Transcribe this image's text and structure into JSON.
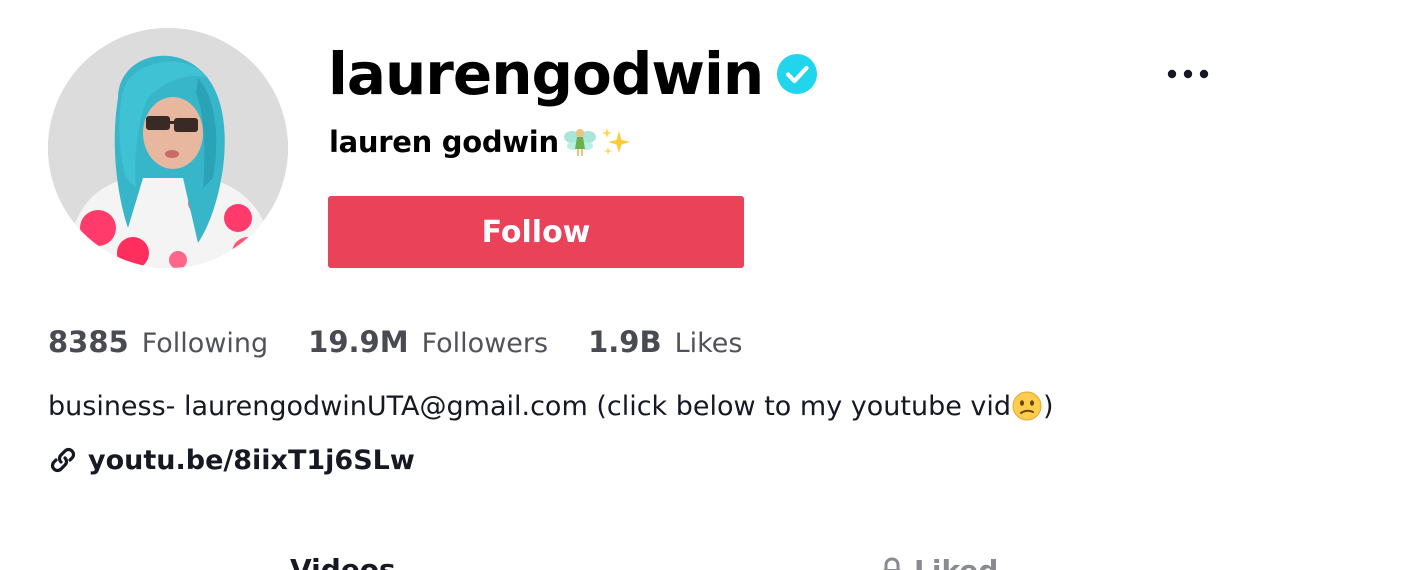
{
  "profile": {
    "username": "laurengodwin",
    "verified": true,
    "display_name": "lauren godwin",
    "display_name_emojis": [
      "fairy-emoji",
      "sparkles-emoji"
    ],
    "avatar_alt": "profile photo"
  },
  "actions": {
    "follow_label": "Follow",
    "more_icon": "ellipsis-icon"
  },
  "stats": {
    "following": {
      "count": "8385",
      "label": "Following"
    },
    "followers": {
      "count": "19.9M",
      "label": "Followers"
    },
    "likes": {
      "count": "1.9B",
      "label": "Likes"
    }
  },
  "bio": {
    "text_before_emoji": "business- laurengodwinUTA@gmail.com (click below to my youtube vid",
    "emoji": "confused-face-emoji",
    "text_after_emoji": ")"
  },
  "link": {
    "icon": "link-icon",
    "url_text": "youtu.be/8iixT1j6SLw"
  },
  "tabs": [
    {
      "label": "Videos"
    },
    {
      "label": "Liked"
    }
  ],
  "colors": {
    "follow_button": "#ea4259",
    "verified_badge": "#20d5ec",
    "stats_text": "#4a4b52"
  }
}
